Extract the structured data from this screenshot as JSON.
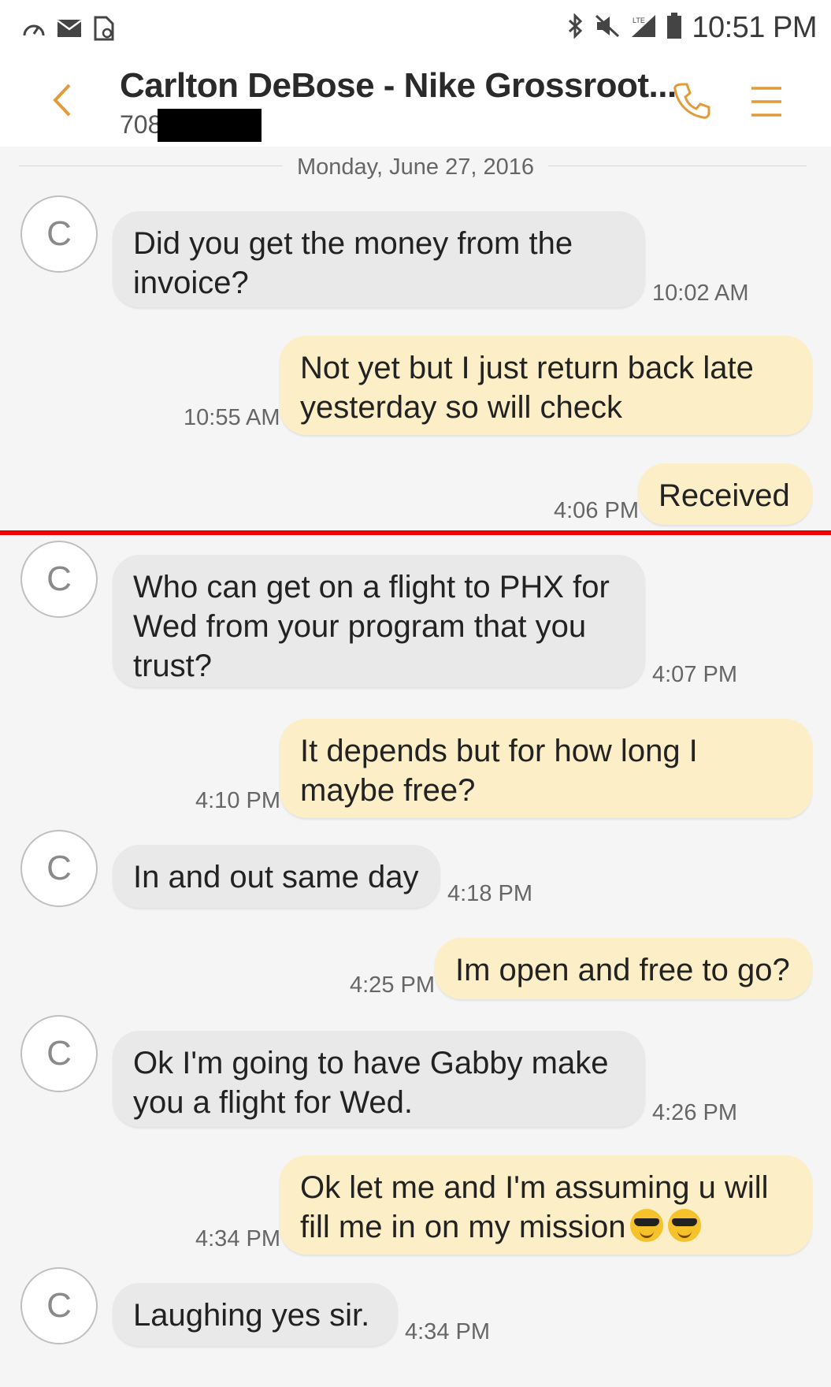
{
  "status_bar": {
    "time": "10:51 PM",
    "left_icons": [
      "speedometer-icon",
      "mail-icon",
      "file-icon"
    ],
    "right_icons": [
      "bluetooth-icon",
      "mute-icon",
      "signal-icon",
      "battery-icon"
    ],
    "network_label": "LTE"
  },
  "header": {
    "title": "Carlton DeBose - Nike Grossroot...",
    "phone_prefix": "708"
  },
  "conversation": {
    "date": "Monday, June 27, 2016",
    "avatar_letter": "C",
    "messages": [
      {
        "direction": "incoming",
        "text_lines": [
          "Did you get the money from the",
          "invoice?"
        ],
        "time": "10:02 AM"
      },
      {
        "direction": "outgoing",
        "text_lines": [
          "Not yet but I just return back late",
          "yesterday so will check"
        ],
        "time": "10:55 AM"
      },
      {
        "direction": "outgoing",
        "text_lines": [
          "Received"
        ],
        "time": "4:06 PM"
      },
      {
        "direction": "incoming",
        "text_lines": [
          "Who can get on a flight to PHX for",
          "Wed from your program that you",
          "trust?"
        ],
        "time": "4:07 PM"
      },
      {
        "direction": "outgoing",
        "text_lines": [
          "It depends but for how long I",
          "maybe free?"
        ],
        "time": "4:10 PM"
      },
      {
        "direction": "incoming",
        "text_lines": [
          "In and out same day"
        ],
        "time": "4:18 PM"
      },
      {
        "direction": "outgoing",
        "text_lines": [
          "Im open and free to go?"
        ],
        "time": "4:25 PM"
      },
      {
        "direction": "incoming",
        "text_lines": [
          "Ok I'm going to have Gabby make",
          "you a flight for Wed."
        ],
        "time": "4:26 PM"
      },
      {
        "direction": "outgoing",
        "text_lines": [
          "Ok let me and I'm assuming u will",
          "fill me in on my mission"
        ],
        "time": "4:34 PM",
        "emoji": [
          "smiling-face-with-sunglasses",
          "smiling-face-with-sunglasses"
        ]
      },
      {
        "direction": "incoming",
        "text_lines": [
          "Laughing yes sir."
        ],
        "time": "4:34 PM"
      }
    ]
  },
  "colors": {
    "accent": "#e39a3b",
    "incoming_bubble": "#e9e9e9",
    "outgoing_bubble": "#fcefc7",
    "highlight_line": "#ee0000"
  }
}
